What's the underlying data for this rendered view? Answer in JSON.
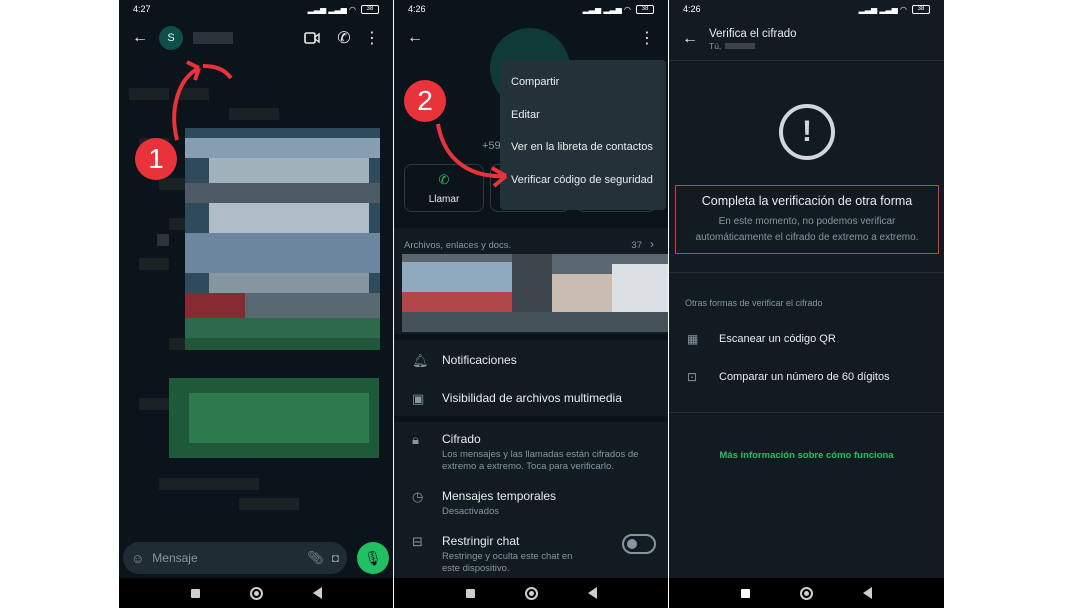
{
  "panel1": {
    "time": "4:27",
    "battery": "38",
    "avatar_letter": "S",
    "input_placeholder": "Mensaje",
    "marker": "1"
  },
  "panel2": {
    "time": "4:26",
    "battery": "38",
    "phone_partial": "+59",
    "marker": "2",
    "menu": [
      "Compartir",
      "Editar",
      "Ver en la libreta de contactos",
      "Verificar código de seguridad"
    ],
    "call_label": "Llamar",
    "media_title": "Archivos, enlaces y docs.",
    "media_count": "37",
    "rows": [
      {
        "title": "Notificaciones",
        "subtitle": ""
      },
      {
        "title": "Visibilidad de archivos multimedia",
        "subtitle": ""
      },
      {
        "title": "Cifrado",
        "subtitle": "Los mensajes y las llamadas están cifrados de extremo a extremo. Toca para verificarlo."
      },
      {
        "title": "Mensajes temporales",
        "subtitle": "Desactivados"
      },
      {
        "title": "Restringir chat",
        "subtitle": "Restringe y oculta este chat en este dispositivo."
      }
    ]
  },
  "panel3": {
    "time": "4:26",
    "battery": "38",
    "title": "Verifica el cifrado",
    "subtitle": "Tú,",
    "heading": "Completa la verificación de otra forma",
    "body": "En este momento, no podemos verificar automáticamente el cifrado de extremo a extremo.",
    "other_ways": "Otras formas de verificar el cifrado",
    "option_qr": "Escanear un código QR",
    "option_number": "Comparar un número de 60 dígitos",
    "more_info": "Más información sobre cómo funciona"
  },
  "colors": {
    "accent_green": "#21c063",
    "marker_red": "#e8333b",
    "background": "#0b141a"
  }
}
